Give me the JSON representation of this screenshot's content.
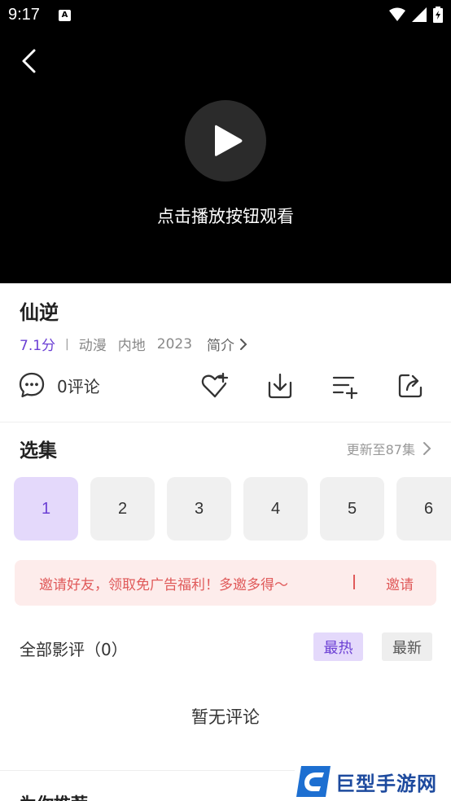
{
  "status_bar": {
    "time": "9:17",
    "notif_badge": "A"
  },
  "player": {
    "hint": "点击播放按钮观看"
  },
  "info": {
    "title": "仙逆",
    "score": "7.1分",
    "separator": "|",
    "genre": "动漫",
    "region": "内地",
    "year": "2023",
    "intro_label": "简介"
  },
  "actions": {
    "comment_count": "0评论",
    "icons": [
      "comment-icon",
      "favorite-icon",
      "download-icon",
      "add-to-playlist-icon",
      "share-icon"
    ]
  },
  "episodes": {
    "title": "选集",
    "update_text": "更新至87集",
    "items": [
      "1",
      "2",
      "3",
      "4",
      "5",
      "6"
    ],
    "selected": "1"
  },
  "invite": {
    "message": "邀请好友，领取免广告福利！多邀多得～",
    "button": "邀请"
  },
  "reviews": {
    "title": "全部影评（0）",
    "sort_hot": "最热",
    "sort_new": "最新",
    "empty_text": "暂无评论"
  },
  "next_section": {
    "title": "为你推荐"
  },
  "watermark": {
    "text": "巨型手游网"
  },
  "colors": {
    "accent": "#6b3fd4",
    "accent_bg": "#e4d9fb",
    "invite_red": "#e05a5a",
    "invite_bg": "#fdeceb"
  }
}
